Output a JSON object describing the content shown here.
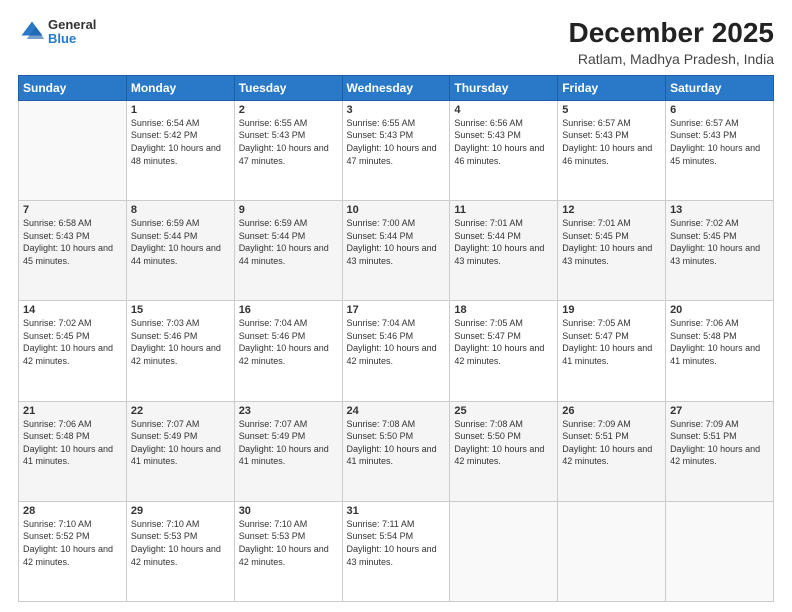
{
  "logo": {
    "general": "General",
    "blue": "Blue"
  },
  "header": {
    "title": "December 2025",
    "subtitle": "Ratlam, Madhya Pradesh, India"
  },
  "days_of_week": [
    "Sunday",
    "Monday",
    "Tuesday",
    "Wednesday",
    "Thursday",
    "Friday",
    "Saturday"
  ],
  "weeks": [
    [
      {
        "day": "",
        "sunrise": "",
        "sunset": "",
        "daylight": ""
      },
      {
        "day": "1",
        "sunrise": "Sunrise: 6:54 AM",
        "sunset": "Sunset: 5:42 PM",
        "daylight": "Daylight: 10 hours and 48 minutes."
      },
      {
        "day": "2",
        "sunrise": "Sunrise: 6:55 AM",
        "sunset": "Sunset: 5:43 PM",
        "daylight": "Daylight: 10 hours and 47 minutes."
      },
      {
        "day": "3",
        "sunrise": "Sunrise: 6:55 AM",
        "sunset": "Sunset: 5:43 PM",
        "daylight": "Daylight: 10 hours and 47 minutes."
      },
      {
        "day": "4",
        "sunrise": "Sunrise: 6:56 AM",
        "sunset": "Sunset: 5:43 PM",
        "daylight": "Daylight: 10 hours and 46 minutes."
      },
      {
        "day": "5",
        "sunrise": "Sunrise: 6:57 AM",
        "sunset": "Sunset: 5:43 PM",
        "daylight": "Daylight: 10 hours and 46 minutes."
      },
      {
        "day": "6",
        "sunrise": "Sunrise: 6:57 AM",
        "sunset": "Sunset: 5:43 PM",
        "daylight": "Daylight: 10 hours and 45 minutes."
      }
    ],
    [
      {
        "day": "7",
        "sunrise": "Sunrise: 6:58 AM",
        "sunset": "Sunset: 5:43 PM",
        "daylight": "Daylight: 10 hours and 45 minutes."
      },
      {
        "day": "8",
        "sunrise": "Sunrise: 6:59 AM",
        "sunset": "Sunset: 5:44 PM",
        "daylight": "Daylight: 10 hours and 44 minutes."
      },
      {
        "day": "9",
        "sunrise": "Sunrise: 6:59 AM",
        "sunset": "Sunset: 5:44 PM",
        "daylight": "Daylight: 10 hours and 44 minutes."
      },
      {
        "day": "10",
        "sunrise": "Sunrise: 7:00 AM",
        "sunset": "Sunset: 5:44 PM",
        "daylight": "Daylight: 10 hours and 43 minutes."
      },
      {
        "day": "11",
        "sunrise": "Sunrise: 7:01 AM",
        "sunset": "Sunset: 5:44 PM",
        "daylight": "Daylight: 10 hours and 43 minutes."
      },
      {
        "day": "12",
        "sunrise": "Sunrise: 7:01 AM",
        "sunset": "Sunset: 5:45 PM",
        "daylight": "Daylight: 10 hours and 43 minutes."
      },
      {
        "day": "13",
        "sunrise": "Sunrise: 7:02 AM",
        "sunset": "Sunset: 5:45 PM",
        "daylight": "Daylight: 10 hours and 43 minutes."
      }
    ],
    [
      {
        "day": "14",
        "sunrise": "Sunrise: 7:02 AM",
        "sunset": "Sunset: 5:45 PM",
        "daylight": "Daylight: 10 hours and 42 minutes."
      },
      {
        "day": "15",
        "sunrise": "Sunrise: 7:03 AM",
        "sunset": "Sunset: 5:46 PM",
        "daylight": "Daylight: 10 hours and 42 minutes."
      },
      {
        "day": "16",
        "sunrise": "Sunrise: 7:04 AM",
        "sunset": "Sunset: 5:46 PM",
        "daylight": "Daylight: 10 hours and 42 minutes."
      },
      {
        "day": "17",
        "sunrise": "Sunrise: 7:04 AM",
        "sunset": "Sunset: 5:46 PM",
        "daylight": "Daylight: 10 hours and 42 minutes."
      },
      {
        "day": "18",
        "sunrise": "Sunrise: 7:05 AM",
        "sunset": "Sunset: 5:47 PM",
        "daylight": "Daylight: 10 hours and 42 minutes."
      },
      {
        "day": "19",
        "sunrise": "Sunrise: 7:05 AM",
        "sunset": "Sunset: 5:47 PM",
        "daylight": "Daylight: 10 hours and 41 minutes."
      },
      {
        "day": "20",
        "sunrise": "Sunrise: 7:06 AM",
        "sunset": "Sunset: 5:48 PM",
        "daylight": "Daylight: 10 hours and 41 minutes."
      }
    ],
    [
      {
        "day": "21",
        "sunrise": "Sunrise: 7:06 AM",
        "sunset": "Sunset: 5:48 PM",
        "daylight": "Daylight: 10 hours and 41 minutes."
      },
      {
        "day": "22",
        "sunrise": "Sunrise: 7:07 AM",
        "sunset": "Sunset: 5:49 PM",
        "daylight": "Daylight: 10 hours and 41 minutes."
      },
      {
        "day": "23",
        "sunrise": "Sunrise: 7:07 AM",
        "sunset": "Sunset: 5:49 PM",
        "daylight": "Daylight: 10 hours and 41 minutes."
      },
      {
        "day": "24",
        "sunrise": "Sunrise: 7:08 AM",
        "sunset": "Sunset: 5:50 PM",
        "daylight": "Daylight: 10 hours and 41 minutes."
      },
      {
        "day": "25",
        "sunrise": "Sunrise: 7:08 AM",
        "sunset": "Sunset: 5:50 PM",
        "daylight": "Daylight: 10 hours and 42 minutes."
      },
      {
        "day": "26",
        "sunrise": "Sunrise: 7:09 AM",
        "sunset": "Sunset: 5:51 PM",
        "daylight": "Daylight: 10 hours and 42 minutes."
      },
      {
        "day": "27",
        "sunrise": "Sunrise: 7:09 AM",
        "sunset": "Sunset: 5:51 PM",
        "daylight": "Daylight: 10 hours and 42 minutes."
      }
    ],
    [
      {
        "day": "28",
        "sunrise": "Sunrise: 7:10 AM",
        "sunset": "Sunset: 5:52 PM",
        "daylight": "Daylight: 10 hours and 42 minutes."
      },
      {
        "day": "29",
        "sunrise": "Sunrise: 7:10 AM",
        "sunset": "Sunset: 5:53 PM",
        "daylight": "Daylight: 10 hours and 42 minutes."
      },
      {
        "day": "30",
        "sunrise": "Sunrise: 7:10 AM",
        "sunset": "Sunset: 5:53 PM",
        "daylight": "Daylight: 10 hours and 42 minutes."
      },
      {
        "day": "31",
        "sunrise": "Sunrise: 7:11 AM",
        "sunset": "Sunset: 5:54 PM",
        "daylight": "Daylight: 10 hours and 43 minutes."
      },
      {
        "day": "",
        "sunrise": "",
        "sunset": "",
        "daylight": ""
      },
      {
        "day": "",
        "sunrise": "",
        "sunset": "",
        "daylight": ""
      },
      {
        "day": "",
        "sunrise": "",
        "sunset": "",
        "daylight": ""
      }
    ]
  ]
}
